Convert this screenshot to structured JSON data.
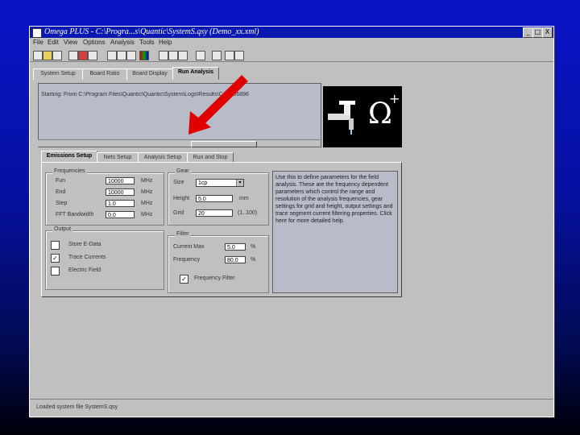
{
  "window": {
    "title": "Omega PLUS - C:\\Progra...s\\Quantic\\SystemS.qsy (Demo_xx.xml)",
    "controls": [
      "_",
      "□",
      "X"
    ]
  },
  "menu": [
    "File",
    "Edit",
    "View",
    "Options",
    "Analysis",
    "Tools",
    "Help"
  ],
  "top_tabs": [
    "System Setup",
    "Board Ratio",
    "Board Display",
    "Run Analysis"
  ],
  "output_text": "Starting: From C:\\Program Files\\Quantic\\Quantic\\System\\Logs\\Results\\C:\\PF36896",
  "logo": {
    "symbol": "Ω",
    "plus": "+"
  },
  "setup_tabs": [
    "Emissions Setup",
    "Nets Setup",
    "Analysis Setup",
    "Run and Stop"
  ],
  "frequencies": {
    "title": "Frequencies",
    "rows": [
      {
        "label": "Fun",
        "value": "10000",
        "unit": "MHz"
      },
      {
        "label": "End",
        "value": "10000",
        "unit": "MHz"
      },
      {
        "label": "Step",
        "value": "1.0",
        "unit": "MHz"
      },
      {
        "label": "FFT Bandwidth",
        "value": "0.0",
        "unit": "MHz"
      }
    ]
  },
  "gear": {
    "title": "Gear",
    "size_label": "Size",
    "size_value": "1cp",
    "height_label": "Height",
    "height_value": "5.0",
    "height_unit": "mm",
    "grid_label": "Grid",
    "grid_value": "20",
    "grid_range": "(1..100)"
  },
  "output": {
    "title": "Output",
    "items": [
      {
        "label": "Store E-Data",
        "checked": false
      },
      {
        "label": "Trace Currents",
        "checked": true
      },
      {
        "label": "Electric Field",
        "checked": false
      }
    ]
  },
  "filter": {
    "title": "Filter",
    "rows": [
      {
        "label": "Current Max",
        "value": "5.0",
        "unit": "%"
      },
      {
        "label": "Frequency",
        "value": "80.0",
        "unit": "%"
      }
    ],
    "freq_filter_label": "Frequency Filter",
    "freq_filter_checked": true
  },
  "help_text": "Use this to define parameters for the field analysis. These are the frequency dependent parameters which control the range and resolution of the analysis frequencies, gear settings for grid and height, output settings and trace segment current filtering properties. Click here for more detailed help.",
  "status": "Loaded system file SystemS.qsy"
}
